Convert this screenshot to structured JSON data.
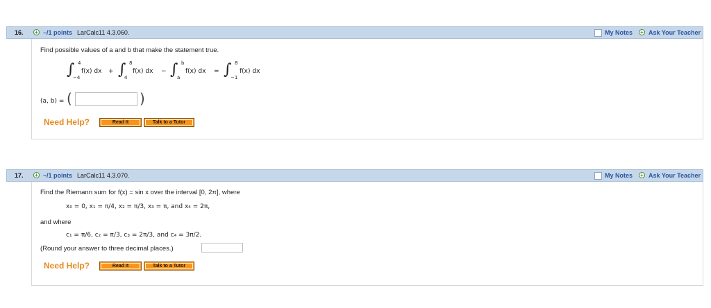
{
  "q16": {
    "number": "16.",
    "points": "–/1 points",
    "reference": "LarCalc11 4.3.060.",
    "my_notes": "My Notes",
    "ask_teacher": "Ask Your Teacher",
    "prompt": "Find possible values of a and b that make the statement true.",
    "integrals": [
      {
        "upper": "4",
        "lower": "−4",
        "integrand": "f(x) dx",
        "op": "+"
      },
      {
        "upper": "8",
        "lower": "4",
        "integrand": "f(x) dx",
        "op": "−"
      },
      {
        "upper": "b",
        "lower": "a",
        "integrand": "f(x) dx",
        "op": "="
      },
      {
        "upper": "8",
        "lower": "−1",
        "integrand": "f(x) dx",
        "op": ""
      }
    ],
    "answer_label": "(a, b) =",
    "answer_value": "",
    "need_help": "Need Help?",
    "read_it": "Read It",
    "talk_tutor": "Talk to a Tutor"
  },
  "q17": {
    "number": "17.",
    "points": "–/1 points",
    "reference": "LarCalc11 4.3.070.",
    "my_notes": "My Notes",
    "ask_teacher": "Ask Your Teacher",
    "prompt": "Find the Riemann sum for f(x) = sin x over the interval [0, 2π], where",
    "x_values": "x₀ = 0, x₁ = π/4,  x₂ = π/3,  x₃ = π, and x₄ = 2π,",
    "and_where": "and where",
    "c_values": "c₁ = π/6,  c₂ = π/3,  c₃ = 2π/3, and c₄ = 3π/2.",
    "round_note": "(Round your answer to three decimal places.)",
    "answer_value": "",
    "need_help": "Need Help?",
    "read_it": "Read It",
    "talk_tutor": "Talk to a Tutor"
  },
  "colors": {
    "header_bg": "#c6d7ea",
    "link_blue": "#2a55a0",
    "help_orange": "#e58a1e",
    "button_orange": "#f7941d"
  }
}
